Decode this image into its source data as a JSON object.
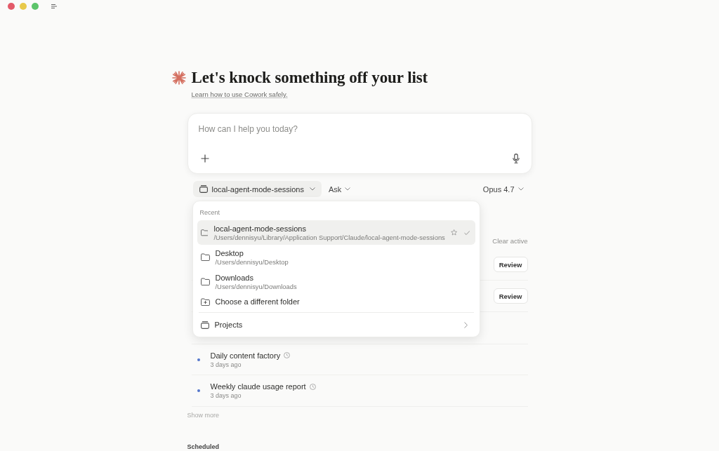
{
  "heading": {
    "title": "Let's knock something off your list",
    "link": "Learn how to use Cowork safely."
  },
  "composer": {
    "placeholder": "How can I help you today?"
  },
  "toolbar": {
    "folder": "local-agent-mode-sessions",
    "mode": "Ask",
    "model": "Opus 4.7"
  },
  "folder_menu": {
    "section": "Recent",
    "folders": [
      {
        "name": "local-agent-mode-sessions",
        "path": "/Users/dennisyu/Library/Application Support/Claude/local-agent-mode-sessions",
        "selected": true
      },
      {
        "name": "Desktop",
        "path": "/Users/dennisyu/Desktop",
        "selected": false
      },
      {
        "name": "Downloads",
        "path": "/Users/dennisyu/Downloads",
        "selected": false
      }
    ],
    "choose": "Choose a different folder",
    "projects": "Projects"
  },
  "active": {
    "action": "Clear active",
    "items": [
      {
        "kind": "review",
        "button": "Review"
      },
      {
        "kind": "review",
        "button": "Review"
      },
      {
        "kind": "task",
        "title": "Daily content factory",
        "time": "3 days ago",
        "unread": true,
        "recurring": true
      },
      {
        "kind": "task",
        "title": "Weekly claude usage report",
        "time": "3 days ago",
        "unread": true,
        "recurring": true
      }
    ],
    "show_more": "Show more"
  },
  "scheduled": {
    "heading": "Scheduled"
  }
}
